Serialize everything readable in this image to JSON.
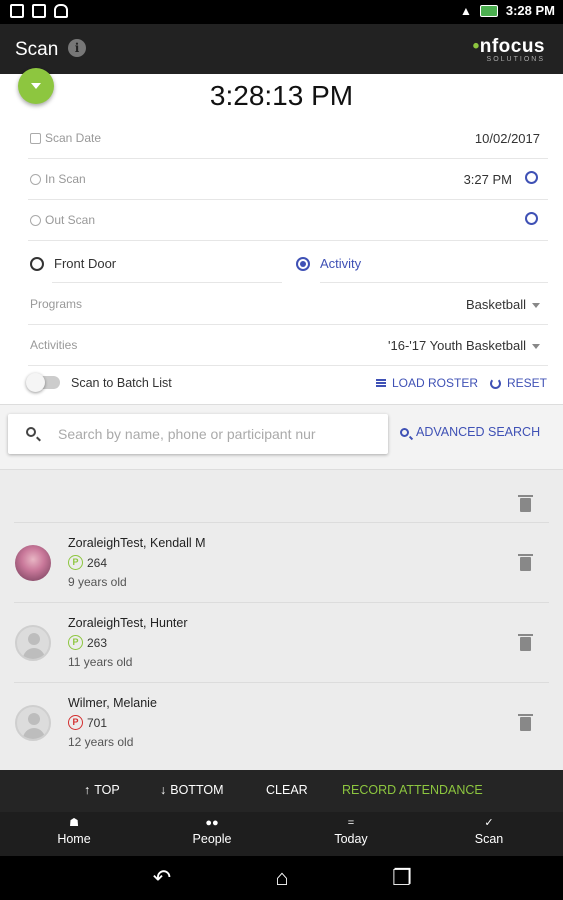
{
  "status_bar": {
    "time": "3:28 PM"
  },
  "app_bar": {
    "title": "Scan",
    "logo_text": "nfocus",
    "logo_sub": "SOLUTIONS"
  },
  "clock": "3:28:13 PM",
  "form": {
    "scan_date": {
      "label": "Scan Date",
      "value": "10/02/2017"
    },
    "in_scan": {
      "label": "In Scan",
      "value": "3:27 PM"
    },
    "out_scan": {
      "label": "Out Scan",
      "value": ""
    },
    "radio_front_door": "Front Door",
    "radio_activity": "Activity",
    "programs": {
      "label": "Programs",
      "value": "Basketball"
    },
    "activities": {
      "label": "Activities",
      "value": "'16-'17 Youth Basketball"
    },
    "batch_label": "Scan to Batch List",
    "load_roster": "LOAD ROSTER",
    "reset": "RESET"
  },
  "search": {
    "placeholder": "Search by name, phone or participant nur",
    "advanced": "ADVANCED SEARCH"
  },
  "people": [
    {
      "name": "ZoraleighTest, Kendall M",
      "badge": "P",
      "id": "264",
      "age": "9 years old",
      "badge_color": "#8dc63f"
    },
    {
      "name": "ZoraleighTest, Hunter",
      "badge": "P",
      "id": "263",
      "age": "11 years old",
      "badge_color": "#8dc63f"
    },
    {
      "name": "Wilmer, Melanie",
      "badge": "P",
      "id": "701",
      "age": "12 years old",
      "badge_color": "#d32f2f"
    }
  ],
  "action_bar": {
    "top": "TOP",
    "bottom": "BOTTOM",
    "clear": "CLEAR",
    "record": "RECORD ATTENDANCE"
  },
  "bottom_nav": {
    "home": "Home",
    "people": "People",
    "today": "Today",
    "scan": "Scan"
  },
  "colors": {
    "accent": "#8dc63f",
    "link": "#3f51b5",
    "appbar": "#222222"
  }
}
